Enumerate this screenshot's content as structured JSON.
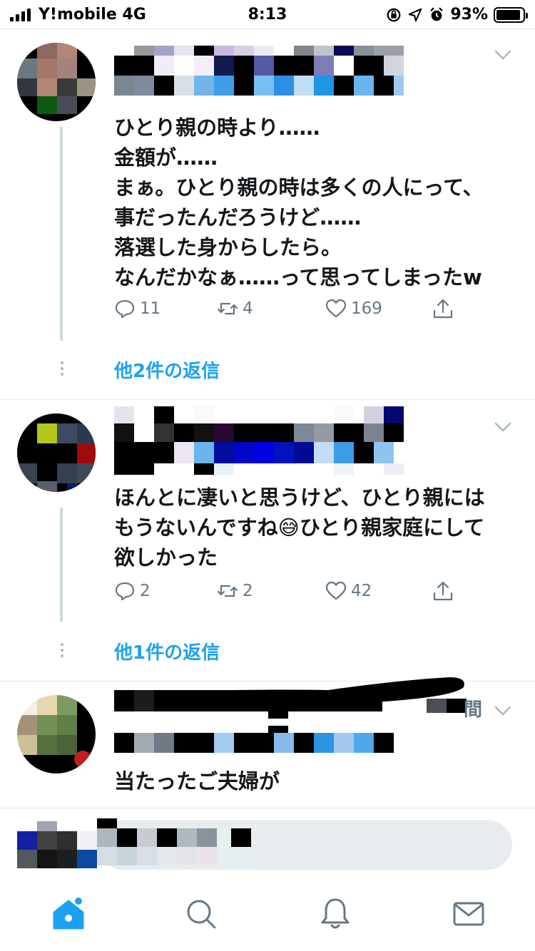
{
  "status_bar": {
    "carrier": "Y!mobile  4G",
    "time": "8:13",
    "battery_percent": "93%",
    "battery_level": 0.93
  },
  "tweets": [
    {
      "text": "ひとり親の時より……\n金額が……\nまぁ。ひとり親の時は多くの人にって、\n事だったんだろうけど……\n落選した身からしたら。\nなんだかなぁ……って思ってしまったw",
      "reply_count": "11",
      "retweet_count": "4",
      "like_count": "169",
      "more_replies": "他2件の返信"
    },
    {
      "text": "ほんとに凄いと思うけど、ひとり親には\nもうないんですね😅ひとり親家庭にして\n欲しかった",
      "reply_count": "2",
      "retweet_count": "2",
      "like_count": "42",
      "more_replies": "他1件の返信"
    },
    {
      "text": "当たったご夫婦が",
      "partial_char": "間"
    }
  ],
  "icons": {
    "reply": "reply-icon",
    "retweet": "retweet-icon",
    "like": "heart-icon",
    "share": "share-icon",
    "chevron": "chevron-down-icon",
    "home": "home-icon",
    "search": "search-icon",
    "notifications": "bell-icon",
    "messages": "mail-icon"
  },
  "colors": {
    "accent": "#1da1f2",
    "secondary_text": "#657786",
    "border": "#e1e8ed"
  }
}
